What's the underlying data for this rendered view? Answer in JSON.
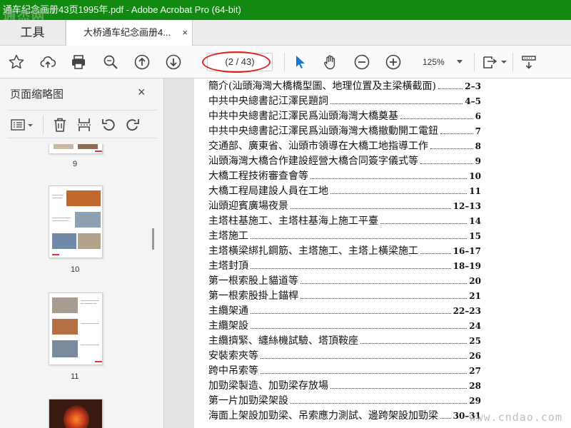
{
  "window": {
    "title": "通车纪念画册43页1995年.pdf - Adobe Acrobat Pro (64-bit)",
    "watermark_top": "通杰网",
    "watermark_bottom": "www.cndao.com"
  },
  "tabs": {
    "tools_label": "工具",
    "document_label": "大桥通车纪念画册4...",
    "close_glyph": "×"
  },
  "toolbar": {
    "page_indicator": "(2 / 43)",
    "zoom": "125%",
    "icons": [
      "star-icon",
      "cloud-upload-icon",
      "print-icon",
      "zoom-search-icon",
      "prev-page-icon",
      "next-page-icon",
      "select-pointer-icon",
      "hand-tool-icon",
      "zoom-out-icon",
      "zoom-in-icon",
      "fit-page-icon",
      "scroll-mode-icon"
    ],
    "accent": "#1a74d2"
  },
  "sidebar": {
    "title": "页面缩略图",
    "close_glyph": "×",
    "tools": [
      "thumbnail-options-icon",
      "delete-page-icon",
      "extract-page-icon",
      "rotate-ccw-icon",
      "rotate-cw-icon"
    ],
    "thumbnails": [
      {
        "label": "9"
      },
      {
        "label": "10"
      },
      {
        "label": "11"
      }
    ]
  },
  "document": {
    "toc": [
      {
        "title": "簡介(汕頭海灣大橋橋型圖、地理位置及主梁橫截面)",
        "page": "2–3"
      },
      {
        "title": "中共中央總書記江澤民題詞",
        "page": "4–5"
      },
      {
        "title": "中共中央總書記江澤民爲汕頭海灣大橋奠基",
        "page": "6"
      },
      {
        "title": "中共中央總書記江澤民爲汕頭海灣大橋撤動開工電鈕",
        "page": "7"
      },
      {
        "title": "交通部、廣東省、汕頭市領導在大橋工地指導工作",
        "page": "8"
      },
      {
        "title": "汕頭海灣大橋合作建設經營大橋合同簽字儀式等",
        "page": "9"
      },
      {
        "title": "大橋工程技術審查會等",
        "page": "10"
      },
      {
        "title": "大橋工程局建設人員在工地",
        "page": "11"
      },
      {
        "title": "汕頭迎賓廣場夜景",
        "page": "12–13"
      },
      {
        "title": "主塔柱基施工、主塔柱基海上施工平臺",
        "page": "14"
      },
      {
        "title": "主塔施工",
        "page": "15"
      },
      {
        "title": "主塔橫梁綁扎鋼筋、主塔施工、主塔上橫梁施工",
        "page": "16–17"
      },
      {
        "title": "主塔封頂",
        "page": "18–19"
      },
      {
        "title": "第一根索股上貓道等",
        "page": "20"
      },
      {
        "title": "第一根索股掛上錨桿",
        "page": "21"
      },
      {
        "title": "主纜架通",
        "page": "22–23"
      },
      {
        "title": "主纜架設",
        "page": "24"
      },
      {
        "title": "主纜擠緊、纏絲機試驗、塔頂鞍座",
        "page": "25"
      },
      {
        "title": "安裝索夾等",
        "page": "26"
      },
      {
        "title": "跨中吊索等",
        "page": "27"
      },
      {
        "title": "加勁梁製造、加勁梁存放場",
        "page": "28"
      },
      {
        "title": "第一片加勁梁架設",
        "page": "29"
      },
      {
        "title": "海面上架設加勁梁、吊索應力測試、邊跨架設加勁梁",
        "page": "30–31"
      }
    ]
  }
}
